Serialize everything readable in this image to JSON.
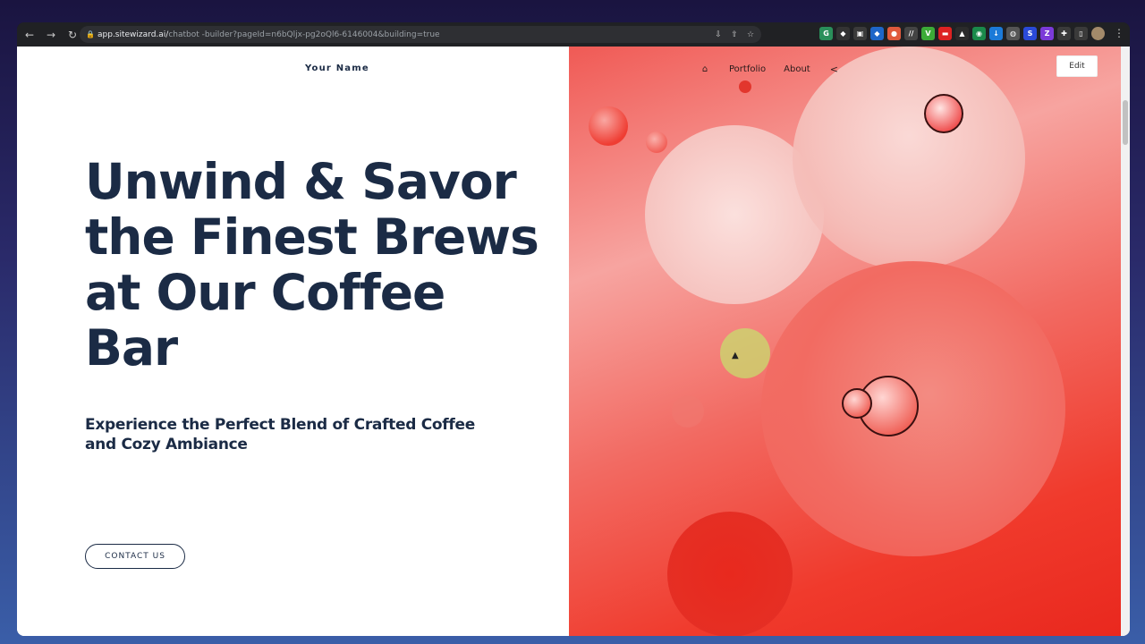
{
  "browser": {
    "url_host": "app.sitewizard.ai/",
    "url_path": "chatbot   -builder?pageId=n6bQljx-pg2oQl6-6146004&building=true"
  },
  "site": {
    "brand": "Your Name",
    "nav": {
      "portfolio": "Portfolio",
      "about": "About"
    },
    "edit_label": "Edit",
    "headline": "Unwind & Savor the Finest Brews at Our Coffee Bar",
    "subheadline": "Experience the Perfect Blend of Crafted Coffee and Cozy Ambiance",
    "cta": "CONTACT US"
  },
  "icons": {
    "back": "arrow-left",
    "forward": "arrow-right",
    "reload": "reload",
    "lock": "lock",
    "home": "home",
    "share": "share"
  },
  "colors": {
    "headline": "#1b2b45",
    "hero_red": "#f03a2c"
  }
}
